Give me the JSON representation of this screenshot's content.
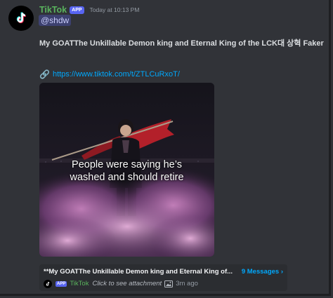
{
  "message": {
    "username": "TikTok",
    "app_badge": "APP",
    "timestamp": "Today at 10:13 PM",
    "mention": "@shdw",
    "text": "My GOATThe Unkillable Demon king and Eternal King of the LCK대 상혁 Faker",
    "link_emoji": "🔗",
    "link": "https://www.tiktok.com/t/ZTLCuRxoT/"
  },
  "embed": {
    "caption_line1": "People were saying he’s",
    "caption_line2": "washed and should retire"
  },
  "thread": {
    "title": "**My GOATThe Unkillable Demon king and Eternal King of...",
    "count": "9 Messages ›",
    "badge": "APP",
    "name": "TikTok",
    "preview": "Click to see attachment",
    "ago": "3m ago"
  },
  "colors": {
    "background": "#313338",
    "username": "#59b35d",
    "link": "#00a8fc",
    "badge": "#5865f2"
  },
  "icons": [
    "tiktok-icon",
    "link-icon",
    "image-icon"
  ]
}
